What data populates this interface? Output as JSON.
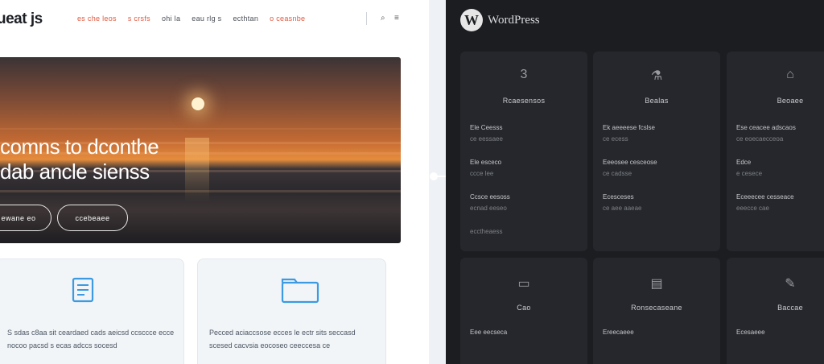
{
  "left_site": {
    "logo": "ueat js",
    "nav": [
      {
        "label": "es che leos"
      },
      {
        "label": "s crsfs"
      },
      {
        "label": "ohi la"
      },
      {
        "label": "eau rlg s"
      },
      {
        "label": "ecthtan"
      },
      {
        "label": "o ceasnbe"
      }
    ],
    "hero": {
      "title_line1": "comns to dconthe",
      "title_line2": "dab ancle sienss",
      "button1": "s ewane eo",
      "button2": "ccebeaee"
    },
    "cards": [
      {
        "icon": "document-icon",
        "text": "S sdas c8aa sit ceardaed cads aeicsd ccsccce ecce nocoo pacsd s ecas adccs socesd"
      },
      {
        "icon": "folder-icon",
        "text": "Pecced aciaccsose ecces le ectr sits seccasd scesed cacvsia eocoseo ceeccesa ce"
      }
    ]
  },
  "right_dash": {
    "brand": "WordPress",
    "cards": [
      {
        "icon": "3",
        "title": "Rcaesensos",
        "lines": [
          "Ele Ceesss",
          "ce eessaee",
          "Ele esceco",
          "ccce lee",
          "Ccsce eesoss",
          "ecnad eeseo",
          "ecctheaess"
        ]
      },
      {
        "icon": "⚗",
        "title": "Bealas",
        "lines": [
          "Ek aeeeese fcslse",
          "ce ecess",
          "Eeeosee cesceose",
          "ce cadsse",
          "Ecesceses",
          "ce aee aaeae",
          ""
        ]
      },
      {
        "icon": "⌂",
        "title": "Beoaee",
        "lines": [
          "Ese ceacee adscaos",
          "ce eoecaecceoa",
          "Edce",
          "e cesece",
          "Eceeecee cesseace",
          "eeecce cae",
          ""
        ]
      },
      {
        "icon": "▭",
        "title": "Cao",
        "lines": [
          "Eee eecseca",
          ""
        ]
      },
      {
        "icon": "▤",
        "title": "Ronsecaseane",
        "lines": [
          "Ereecaeee",
          ""
        ]
      },
      {
        "icon": "✎",
        "title": "Baccae",
        "lines": [
          "Ecesaeee",
          ""
        ]
      }
    ]
  }
}
